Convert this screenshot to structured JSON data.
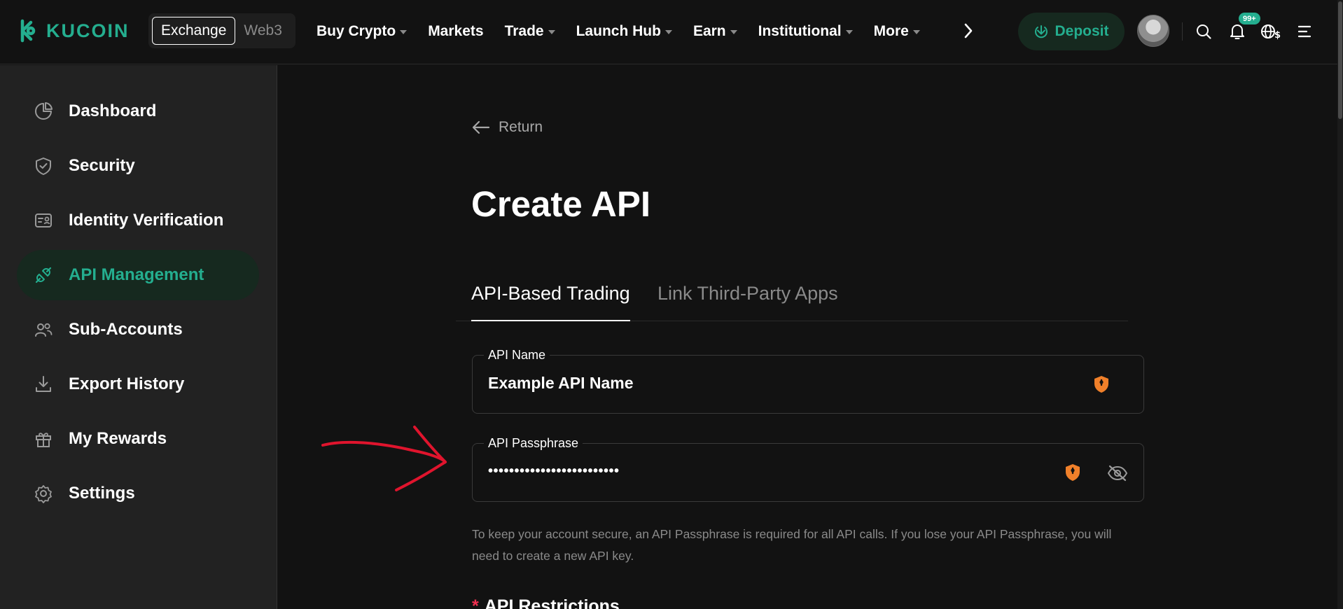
{
  "brand": {
    "name": "KUCOIN",
    "color": "#24ae8f"
  },
  "header": {
    "switcher": {
      "active": "Exchange",
      "inactive": "Web3"
    },
    "nav": [
      {
        "label": "Buy Crypto",
        "dropdown": true
      },
      {
        "label": "Markets",
        "dropdown": false
      },
      {
        "label": "Trade",
        "dropdown": true
      },
      {
        "label": "Launch Hub",
        "dropdown": true
      },
      {
        "label": "Earn",
        "dropdown": true
      },
      {
        "label": "Institutional",
        "dropdown": true
      },
      {
        "label": "More",
        "dropdown": true
      }
    ],
    "deposit_label": "Deposit",
    "notification_badge": "99+",
    "icons": [
      "search-icon",
      "bell-icon",
      "globe-currency-icon",
      "menu-icon"
    ]
  },
  "sidebar": {
    "items": [
      {
        "label": "Dashboard",
        "icon": "pie-chart-icon",
        "active": false
      },
      {
        "label": "Security",
        "icon": "shield-icon",
        "active": false
      },
      {
        "label": "Identity Verification",
        "icon": "id-card-icon",
        "active": false
      },
      {
        "label": "API Management",
        "icon": "plug-icon",
        "active": true
      },
      {
        "label": "Sub-Accounts",
        "icon": "users-icon",
        "active": false
      },
      {
        "label": "Export History",
        "icon": "download-icon",
        "active": false
      },
      {
        "label": "My Rewards",
        "icon": "gift-icon",
        "active": false
      },
      {
        "label": "Settings",
        "icon": "gear-icon",
        "active": false
      }
    ]
  },
  "main": {
    "return_label": "Return",
    "title": "Create API",
    "tabs": [
      {
        "label": "API-Based Trading",
        "active": true
      },
      {
        "label": "Link Third-Party Apps",
        "active": false
      }
    ],
    "api_name": {
      "label": "API Name",
      "value": "Example API Name"
    },
    "api_passphrase": {
      "label": "API Passphrase",
      "value": "•••••••••••••••••••••••••"
    },
    "hint": "To keep your account secure, an API Passphrase is required for all API calls. If you lose your API Passphrase, you will need to create a new API key.",
    "restrictions_label": "API Restrictions",
    "required_mark": "*"
  },
  "colors": {
    "accent": "#24ae8f",
    "warning_shield": "#f0802a",
    "required": "#f23051",
    "annotation": "#e0142d"
  }
}
